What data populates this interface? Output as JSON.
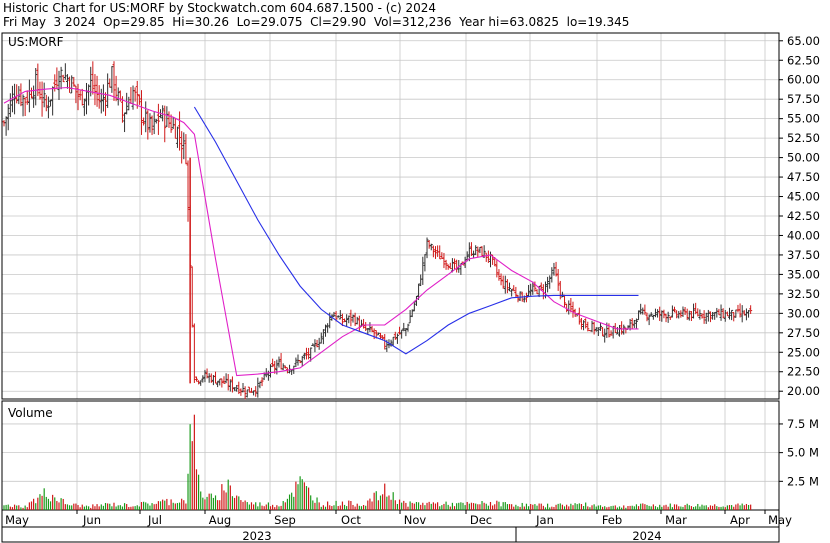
{
  "header": {
    "line1": "Historic Chart for US:MORF by Stockwatch.com 604.687.1500 - (c) 2024",
    "line2": "Fri May  3 2024  Op=29.85  Hi=30.26  Lo=29.075  Cl=29.90  Vol=312,236  Year hi=63.0825  lo=19.345"
  },
  "chart_data": [
    {
      "type": "ohlc",
      "symbol_label": "US:MORF",
      "ylim": [
        19,
        66
      ],
      "y_ticks": [
        "65.00",
        "62.50",
        "60.00",
        "57.50",
        "55.00",
        "52.50",
        "50.00",
        "47.50",
        "45.00",
        "42.50",
        "40.00",
        "37.50",
        "35.00",
        "32.50",
        "30.00",
        "27.50",
        "25.00",
        "22.50",
        "20.00"
      ],
      "y_tick_values": [
        65,
        62.5,
        60,
        57.5,
        55,
        52.5,
        50,
        47.5,
        45,
        42.5,
        40,
        37.5,
        35,
        32.5,
        30,
        27.5,
        25,
        22.5,
        20
      ],
      "x_months": [
        "May",
        "Jun",
        "Jul",
        "Aug",
        "Sep",
        "Oct",
        "Nov",
        "Dec",
        "Jan",
        "Feb",
        "Mar",
        "Apr",
        "May"
      ],
      "x_years": [
        "2023",
        "2024"
      ],
      "close_series": {
        "x": [
          0,
          5,
          10,
          15,
          20,
          26,
          31,
          36,
          41,
          46,
          51,
          56,
          61,
          66,
          70,
          74,
          78,
          82,
          86,
          88,
          90,
          91,
          95,
          100,
          105,
          110,
          115,
          120,
          125,
          130,
          135,
          140,
          145,
          150,
          155,
          160,
          165,
          170,
          175,
          180,
          185,
          190,
          195,
          200,
          205,
          210,
          215,
          220,
          225,
          230,
          235,
          240,
          245,
          250,
          255,
          260,
          265,
          270,
          275,
          280,
          285,
          290,
          295,
          300,
          305,
          310,
          315,
          320,
          325,
          330,
          335,
          340,
          345,
          350,
          353
        ],
        "close": [
          54.5,
          58.5,
          57.5,
          59.5,
          56.5,
          61,
          60,
          57.5,
          59.5,
          57,
          60.5,
          55.5,
          58.5,
          55,
          53.5,
          55.5,
          54.5,
          53.5,
          50.5,
          36,
          22,
          21.5,
          22,
          21.5,
          21,
          20.5,
          20,
          20.5,
          22.5,
          23.5,
          23,
          24,
          25,
          27,
          30,
          29,
          29.5,
          28,
          27.5,
          26,
          27,
          28,
          32,
          39,
          37.5,
          36.5,
          35.5,
          38,
          38,
          37,
          34,
          33,
          32,
          33,
          33,
          35.5,
          31,
          30,
          28.5,
          28,
          27.5,
          28,
          28,
          29.9,
          29.9,
          29.9,
          29.9,
          29.9,
          29.9,
          29.9,
          29.9,
          29.9,
          29.9,
          29.9,
          29.9
        ]
      },
      "series": [
        {
          "name": "",
          "color": "#e020c8",
          "x": [
            0,
            10,
            20,
            30,
            40,
            50,
            60,
            70,
            80,
            85,
            90,
            95,
            100,
            110,
            120,
            130,
            140,
            150,
            160,
            170,
            180,
            190,
            200,
            210,
            220,
            230,
            240,
            250,
            260,
            270,
            280,
            290,
            300
          ],
          "values": [
            57,
            58.5,
            58.8,
            59,
            58.5,
            58,
            57,
            56,
            55.2,
            54.5,
            53,
            45,
            37,
            22,
            22.2,
            22.5,
            23,
            25,
            27,
            28.5,
            28.5,
            30.5,
            33,
            35,
            37,
            37.5,
            35.5,
            34,
            31.5,
            30,
            29,
            28,
            28
          ]
        },
        {
          "name": "",
          "color": "#2830e8",
          "x": [
            90,
            100,
            110,
            120,
            130,
            140,
            150,
            160,
            170,
            180,
            190,
            200,
            210,
            220,
            230,
            240,
            250,
            260,
            270,
            280,
            290,
            300
          ],
          "values": [
            56.5,
            52,
            47,
            42,
            37.5,
            33.5,
            30.5,
            28.5,
            27.5,
            26.5,
            24.8,
            26.5,
            28.5,
            30,
            31,
            32,
            32.2,
            32.3,
            32.3,
            32.3,
            32.3,
            32.3
          ]
        }
      ]
    },
    {
      "type": "bar",
      "title": "Volume",
      "y_ticks": [
        "7.5 M",
        "5.0 M",
        "2.5 M"
      ],
      "y_tick_values": [
        7.5,
        5,
        2.5
      ],
      "ylim": [
        0,
        9.5
      ],
      "x": [
        0,
        10,
        20,
        30,
        40,
        50,
        60,
        70,
        80,
        86,
        87,
        88,
        89,
        90,
        91,
        92,
        93,
        95,
        100,
        105,
        110,
        115,
        120,
        125,
        130,
        140,
        150,
        160,
        170,
        180,
        190,
        200,
        210,
        220,
        230,
        240,
        250,
        260,
        270,
        280,
        290,
        300
      ],
      "values": [
        0.4,
        0.3,
        1.5,
        0.5,
        0.3,
        0.5,
        0.4,
        0.6,
        0.8,
        0.9,
        2.5,
        5.8,
        8.8,
        6,
        3.2,
        2.5,
        1.8,
        1.2,
        0.9,
        2.3,
        1.2,
        0.6,
        0.5,
        0.5,
        0.4,
        2.3,
        0.5,
        0.6,
        0.5,
        1.6,
        0.5,
        0.6,
        0.5,
        0.5,
        0.6,
        0.5,
        0.4,
        0.4,
        0.5,
        0.4,
        0.3,
        0.4
      ]
    }
  ],
  "colors": {
    "up": "#1a9a1a",
    "down": "#d01818",
    "bar_dark": "#303030",
    "grid": "#c8c8c8"
  }
}
